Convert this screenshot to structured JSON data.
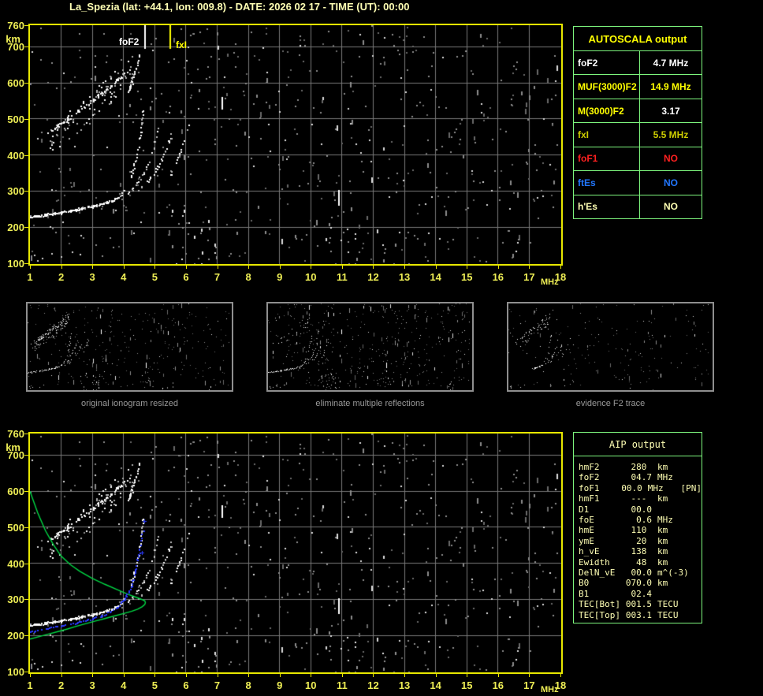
{
  "title": "La_Spezia (lat: +44.1, lon: 009.8) - DATE: 2026 02 17 - TIME (UT): 00:00",
  "colors": {
    "title": "#ffffb4",
    "axis_labels": "#eeee55",
    "plot_border": "#e8e800",
    "grid": "#787878",
    "table_border": "#7df57d",
    "white": "#ffffff",
    "yellow": "#ffff00",
    "dim_yellow": "#cccc00",
    "pale_yellow": "#ffffb4",
    "red": "#ff2020",
    "blue": "#2277ff",
    "profile_green": "#00d944",
    "trace_blue": "#2b3bff",
    "caption_gray": "#9a9a9a"
  },
  "autoscala_table": {
    "header": "AUTOSCALA output",
    "rows": [
      {
        "label": "foF2",
        "value": "4.7 MHz",
        "label_color": "#ffffff",
        "value_color": "#ffffff"
      },
      {
        "label": "MUF(3000)F2",
        "value": "14.9 MHz",
        "label_color": "#ffff00",
        "value_color": "#ffff00"
      },
      {
        "label": "M(3000)F2",
        "value": "3.17",
        "label_color": "#ffff00",
        "value_color": "#ffffff"
      },
      {
        "label": "fxI",
        "value": "5.5 MHz",
        "label_color": "#cccc00",
        "value_color": "#cccc00"
      },
      {
        "label": "foF1",
        "value": "NO",
        "label_color": "#ff2020",
        "value_color": "#ff2020"
      },
      {
        "label": "ftEs",
        "value": "NO",
        "label_color": "#2277ff",
        "value_color": "#2277ff"
      },
      {
        "label": "h'Es",
        "value": "NO",
        "label_color": "#ffffb4",
        "value_color": "#ffffb4"
      }
    ]
  },
  "aip_table": {
    "header": "AIP output",
    "rows": [
      {
        "name": "hmF2",
        "value": "280 ",
        "unit": "km",
        "extra": ""
      },
      {
        "name": "foF2",
        "value": "04.7",
        "unit": "MHz",
        "extra": ""
      },
      {
        "name": "foF1",
        "value": "00.0",
        "unit": "MHz",
        "extra": "[PN]"
      },
      {
        "name": "hmF1",
        "value": "--- ",
        "unit": "km",
        "extra": ""
      },
      {
        "name": "D1",
        "value": "00.0",
        "unit": "",
        "extra": ""
      },
      {
        "name": "foE",
        "value": "0.6",
        "unit": "MHz",
        "extra": ""
      },
      {
        "name": "hmE",
        "value": "110 ",
        "unit": "km",
        "extra": ""
      },
      {
        "name": "ymE",
        "value": "20 ",
        "unit": "km",
        "extra": ""
      },
      {
        "name": "h_vE",
        "value": "138 ",
        "unit": "km",
        "extra": ""
      },
      {
        "name": "Ewidth",
        "value": "48 ",
        "unit": "km",
        "extra": ""
      },
      {
        "name": "DelN_vE",
        "value": "00.0",
        "unit": "m^(-3)",
        "extra": ""
      },
      {
        "name": "B0",
        "value": "070.0",
        "unit": "km",
        "extra": ""
      },
      {
        "name": "B1",
        "value": "02.4",
        "unit": "",
        "extra": ""
      },
      {
        "name": "TEC[Bot]",
        "value": "001.5",
        "unit": "TECU",
        "extra": ""
      },
      {
        "name": "TEC[Top]",
        "value": "003.1",
        "unit": "TECU",
        "extra": ""
      }
    ]
  },
  "thumbnails": [
    {
      "caption": "original ionogram resized"
    },
    {
      "caption": "eliminate multiple reflections"
    },
    {
      "caption": "evidence F2 trace"
    }
  ],
  "chart_data": {
    "type": "scatter",
    "title": "ionogram height vs frequency",
    "x_unit": "MHz",
    "y_unit": "km",
    "x_range": [
      1,
      18
    ],
    "y_range": [
      100,
      760
    ],
    "x_ticks": [
      1,
      2,
      3,
      4,
      5,
      6,
      7,
      8,
      9,
      10,
      11,
      12,
      13,
      14,
      15,
      16,
      17,
      18
    ],
    "y_ticks": [
      760,
      700,
      600,
      500,
      400,
      300,
      200,
      100
    ],
    "markers": [
      {
        "label": "foF2",
        "freq": 4.7,
        "color": "#ffffff"
      },
      {
        "label": "fxI",
        "freq": 5.5,
        "color": "#ffff00"
      }
    ],
    "traces": {
      "flat": [
        [
          1.0,
          228
        ],
        [
          1.5,
          234
        ],
        [
          2.0,
          241
        ],
        [
          2.5,
          249
        ],
        [
          3.0,
          258
        ],
        [
          3.3,
          264
        ],
        [
          3.6,
          273
        ],
        [
          3.85,
          284
        ]
      ],
      "branches": [
        [
          [
            3.85,
            284
          ],
          [
            4.05,
            308
          ],
          [
            4.2,
            335
          ],
          [
            4.32,
            365
          ],
          [
            4.42,
            400
          ],
          [
            4.5,
            435
          ],
          [
            4.56,
            470
          ],
          [
            4.6,
            505
          ],
          [
            4.63,
            525
          ]
        ],
        [
          [
            4.15,
            292
          ],
          [
            4.4,
            318
          ],
          [
            4.62,
            348
          ],
          [
            4.82,
            383
          ],
          [
            4.97,
            418
          ],
          [
            5.07,
            452
          ],
          [
            5.15,
            482
          ]
        ],
        [
          [
            4.5,
            302
          ],
          [
            4.82,
            332
          ],
          [
            5.1,
            368
          ],
          [
            5.3,
            402
          ],
          [
            5.44,
            432
          ],
          [
            5.52,
            458
          ]
        ],
        [
          [
            5.5,
            340
          ],
          [
            5.7,
            380
          ],
          [
            5.85,
            420
          ],
          [
            6.0,
            455
          ],
          [
            6.1,
            482
          ]
        ]
      ],
      "steep_tail": [
        [
          4.15,
          575
        ],
        [
          4.3,
          615
        ],
        [
          4.42,
          650
        ],
        [
          4.5,
          678
        ]
      ],
      "cluster": [
        [
          [
            1.35,
            448
          ],
          [
            1.95,
            485
          ]
        ],
        [
          [
            1.55,
            458
          ],
          [
            2.35,
            515
          ]
        ],
        [
          [
            1.85,
            472
          ],
          [
            2.75,
            542
          ]
        ],
        [
          [
            2.15,
            492
          ],
          [
            3.15,
            568
          ]
        ],
        [
          [
            2.55,
            518
          ],
          [
            3.55,
            592
          ]
        ],
        [
          [
            2.95,
            548
          ],
          [
            3.95,
            618
          ]
        ],
        [
          [
            3.35,
            572
          ],
          [
            4.25,
            645
          ]
        ]
      ],
      "cluster_band": {
        "f1": 1.6,
        "f2": 4.3,
        "base": 432,
        "slope": 75,
        "spread": 42,
        "count": 85
      },
      "dashes": [
        {
          "f": 7.15,
          "h1": 523,
          "h2": 560
        },
        {
          "f": 10.9,
          "h1": 258,
          "h2": 303
        }
      ],
      "columns": [
        {
          "f": 5.55,
          "h1": 100,
          "h2": 275
        },
        {
          "f": 5.72,
          "h1": 100,
          "h2": 250
        },
        {
          "f": 5.9,
          "h1": 100,
          "h2": 290
        },
        {
          "f": 6.08,
          "h1": 100,
          "h2": 240
        },
        {
          "f": 6.28,
          "h1": 100,
          "h2": 265
        },
        {
          "f": 6.5,
          "h1": 100,
          "h2": 215
        },
        {
          "f": 6.7,
          "h1": 100,
          "h2": 250
        },
        {
          "f": 6.95,
          "h1": 100,
          "h2": 180
        },
        {
          "f": 10.62,
          "h1": 100,
          "h2": 230
        },
        {
          "f": 10.8,
          "h1": 100,
          "h2": 200
        },
        {
          "f": 11.0,
          "h1": 100,
          "h2": 255
        },
        {
          "f": 11.2,
          "h1": 100,
          "h2": 215
        },
        {
          "f": 11.45,
          "h1": 100,
          "h2": 185
        },
        {
          "f": 12.35,
          "h1": 100,
          "h2": 190
        },
        {
          "f": 12.7,
          "h1": 100,
          "h2": 165
        },
        {
          "f": 13.1,
          "h1": 100,
          "h2": 185
        },
        {
          "f": 16.3,
          "h1": 100,
          "h2": 175
        },
        {
          "f": 16.6,
          "h1": 100,
          "h2": 200
        }
      ],
      "edots": [
        [
          1.15,
          122
        ],
        [
          1.4,
          114
        ],
        [
          1.7,
          128
        ],
        [
          2.0,
          118
        ],
        [
          2.35,
          131
        ],
        [
          1.25,
          108
        ]
      ]
    },
    "profile_green": [
      [
        1.0,
        600
      ],
      [
        1.25,
        540
      ],
      [
        1.5,
        490
      ],
      [
        1.75,
        452
      ],
      [
        2.0,
        420
      ],
      [
        2.3,
        396
      ],
      [
        2.6,
        378
      ],
      [
        3.0,
        358
      ],
      [
        3.4,
        342
      ],
      [
        3.8,
        327
      ],
      [
        4.15,
        314
      ],
      [
        4.4,
        306
      ],
      [
        4.58,
        300
      ],
      [
        4.68,
        296
      ],
      [
        4.7,
        291
      ],
      [
        4.68,
        286
      ],
      [
        4.6,
        280
      ],
      [
        4.45,
        273
      ],
      [
        4.25,
        267
      ],
      [
        4.0,
        261
      ],
      [
        3.7,
        254
      ],
      [
        3.4,
        247
      ],
      [
        3.1,
        240
      ],
      [
        2.8,
        233
      ],
      [
        2.5,
        226
      ],
      [
        2.2,
        218
      ],
      [
        1.9,
        211
      ],
      [
        1.6,
        204
      ],
      [
        1.3,
        197
      ],
      [
        1.0,
        190
      ]
    ],
    "restored_trace_blue": {
      "points": [
        [
          1.0,
          212
        ],
        [
          1.5,
          218
        ],
        [
          2.0,
          226
        ],
        [
          2.5,
          235
        ],
        [
          3.0,
          246
        ],
        [
          3.3,
          255
        ],
        [
          3.6,
          268
        ],
        [
          3.8,
          280
        ],
        [
          3.95,
          293
        ],
        [
          4.1,
          310
        ],
        [
          4.2,
          330
        ],
        [
          4.3,
          355
        ],
        [
          4.38,
          383
        ],
        [
          4.45,
          410
        ],
        [
          4.5,
          436
        ],
        [
          4.56,
          463
        ],
        [
          4.62,
          492
        ]
      ],
      "crosses": [
        [
          4.68,
          516
        ],
        [
          4.6,
          430
        ]
      ]
    }
  }
}
